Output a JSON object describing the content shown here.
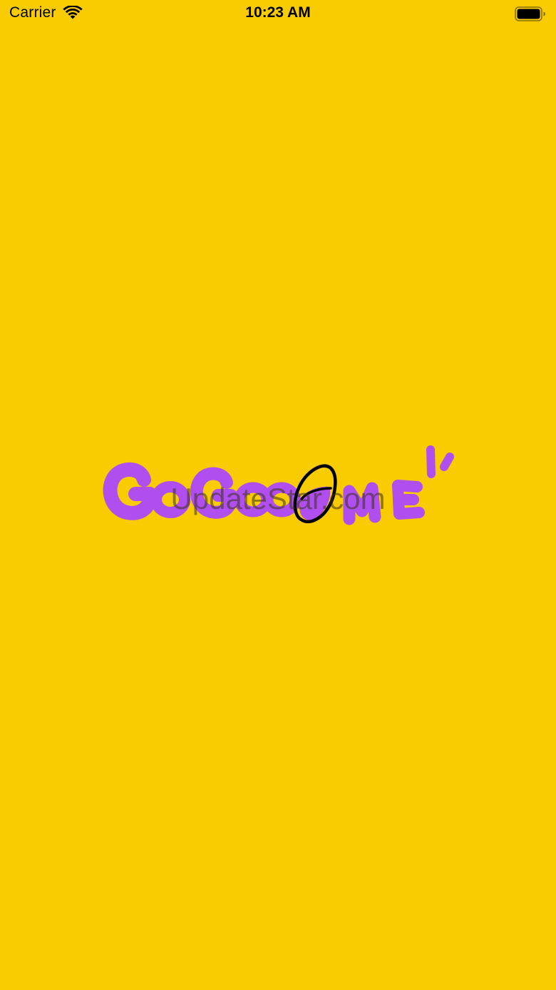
{
  "status_bar": {
    "carrier": "Carrier",
    "time": "10:23 AM",
    "icons": [
      "wifi-icon",
      "battery-icon"
    ]
  },
  "splash": {
    "logo_text": "GoGooME",
    "watermark": "UpdateStar.com"
  },
  "colors": {
    "background": "#F8CC00",
    "logo_purple": "#B04EF0",
    "outline": "#000000"
  }
}
